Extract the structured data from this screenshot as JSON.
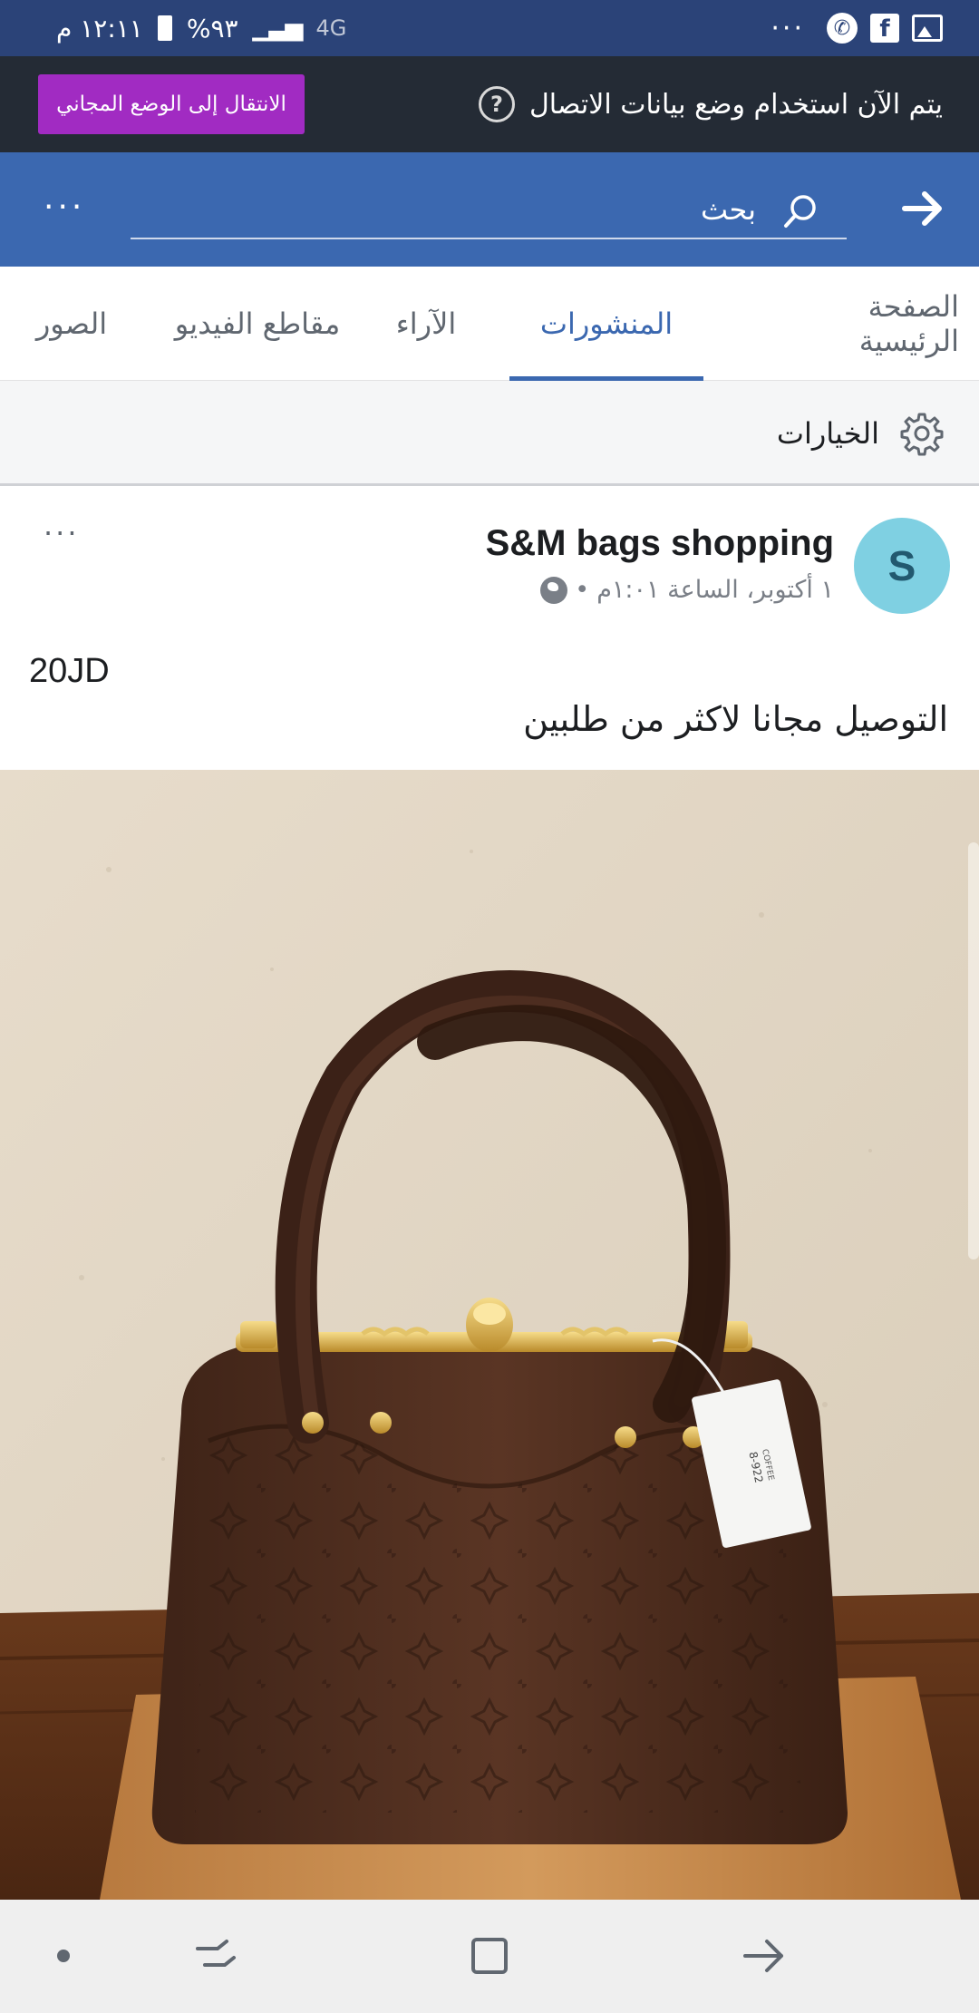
{
  "status_bar": {
    "time": "١٢:١١ م",
    "battery": "%٩٣",
    "network": "4G",
    "more": "···"
  },
  "data_banner": {
    "message": "يتم الآن استخدام وضع بيانات الاتصال",
    "help_symbol": "?",
    "free_mode_button": "الانتقال إلى الوضع المجاني"
  },
  "header": {
    "search_placeholder": "بحث",
    "more": "···"
  },
  "tabs": [
    {
      "label": "الصفحة الرئيسية",
      "active": false
    },
    {
      "label": "المنشورات",
      "active": true
    },
    {
      "label": "الآراء",
      "active": false
    },
    {
      "label": "مقاطع الفيديو",
      "active": false
    },
    {
      "label": "الصور",
      "active": false
    }
  ],
  "options": {
    "label": "الخيارات"
  },
  "post": {
    "avatar_letter": "S",
    "page_name": "S&M bags shopping",
    "timestamp": "١ أكتوبر، الساعة ١:٠١م",
    "separator": "•",
    "more": "···",
    "price": "20JD",
    "description": "التوصيل مجانا لاكثر من طلبين",
    "tag_text": "8-922",
    "tag_subtext": "COFFEE"
  },
  "colors": {
    "status_bar": "#2b4378",
    "banner": "#242b35",
    "free_button": "#a12bc2",
    "header": "#3b68b0",
    "active_tab": "#3b68b0",
    "avatar": "#7fd0e2"
  },
  "icons": [
    "phone-icon",
    "facebook-icon",
    "image-icon",
    "wifi-icon",
    "signal-icon",
    "battery-icon",
    "help-icon",
    "back-arrow-icon",
    "search-icon",
    "more-icon",
    "gear-icon",
    "globe-icon",
    "home-dot-icon",
    "recents-icon",
    "overview-icon",
    "back-icon"
  ]
}
